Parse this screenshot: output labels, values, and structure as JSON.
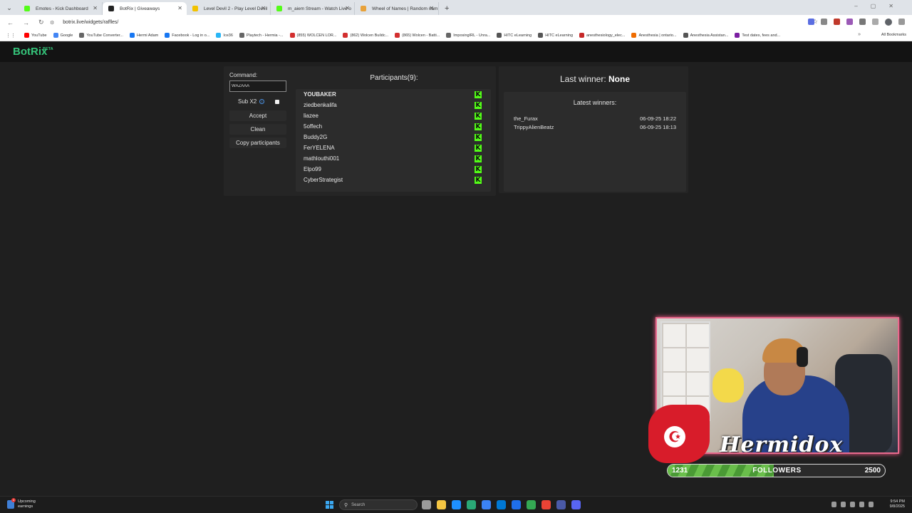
{
  "browser": {
    "tabs": [
      {
        "label": "Emotes - Kick Dashboard",
        "active": false,
        "color": "#53fc18"
      },
      {
        "label": "BotRix | Giveaways",
        "active": true,
        "color": "#222222"
      },
      {
        "label": "Level Devil 2 - Play Level Devil",
        "active": false,
        "color": "#f2c200"
      },
      {
        "label": "m_aiem Stream - Watch Live o",
        "active": false,
        "color": "#53fc18"
      },
      {
        "label": "Wheel of Names | Random nam",
        "active": false,
        "color": "#e8a23a"
      }
    ],
    "url": "botrix.live/widgets/raffles/",
    "bookmarks": [
      {
        "label": "YouTube",
        "color": "#ff0000"
      },
      {
        "label": "Google",
        "color": "#4285f4"
      },
      {
        "label": "YouTube Converter...",
        "color": "#666666"
      },
      {
        "label": "Hermi Adam",
        "color": "#1877f2"
      },
      {
        "label": "Facebook - Log in o...",
        "color": "#1877f2"
      },
      {
        "label": "Ice36",
        "color": "#29b6f6"
      },
      {
        "label": "Playtech - Hermia -...",
        "color": "#666666"
      },
      {
        "label": "(855) WOLCEN LOR...",
        "color": "#d32f2f"
      },
      {
        "label": "(862) Wolcen Buildc...",
        "color": "#d32f2f"
      },
      {
        "label": "(865) Wolcen - Batti...",
        "color": "#d32f2f"
      },
      {
        "label": "ImposingIRL - Unra...",
        "color": "#666666"
      },
      {
        "label": "HITC eLearning",
        "color": "#555555"
      },
      {
        "label": "HITC eLearning",
        "color": "#555555"
      },
      {
        "label": "anesthesiology_elec...",
        "color": "#c62828"
      },
      {
        "label": "Anesthesia | ontario...",
        "color": "#ef6c00"
      },
      {
        "label": "Anesthesia Assistan...",
        "color": "#555555"
      },
      {
        "label": "Test dates, fees and...",
        "color": "#7b1fa2"
      }
    ],
    "all_bookmarks_label": "All Bookmarks"
  },
  "app": {
    "logo": "BotRix",
    "logo_badge": "BETA",
    "command_label": "Command:",
    "command_value": "WAZAAA",
    "sub_label": "Sub X2",
    "accept_label": "Accept",
    "clean_label": "Clean",
    "copy_label": "Copy participants",
    "participants_title": "Participants(9):",
    "participants": [
      {
        "name": "YOUBAKER",
        "bold": true
      },
      {
        "name": "ziedbenkalifa",
        "bold": false
      },
      {
        "name": "liazee",
        "bold": false
      },
      {
        "name": "5offech",
        "bold": false
      },
      {
        "name": "Buddy2G",
        "bold": false
      },
      {
        "name": "FerYELENA",
        "bold": false
      },
      {
        "name": "mathlouthi001",
        "bold": false
      },
      {
        "name": "Elpo99",
        "bold": false
      },
      {
        "name": "CyberStrategist",
        "bold": false
      }
    ],
    "platform_glyph": "K",
    "last_winner_label": "Last winner:",
    "last_winner_value": "None",
    "latest_winners_title": "Latest winners:",
    "latest_winners": [
      {
        "name": "the_Furax",
        "date": "06-09-25 18:22"
      },
      {
        "name": "TrippyAlienBeatz",
        "date": "06-09-25 18:13"
      }
    ]
  },
  "overlay": {
    "streamer_name": "Hermidox",
    "followers_current": "1231",
    "followers_label": "FOLLOWERS",
    "followers_goal": "2500",
    "followers_fraction": 0.49
  },
  "taskbar": {
    "weather_line1": "Upcoming",
    "weather_line2": "earnings",
    "search_placeholder": "Search",
    "time": "9:54 PM",
    "date": "9/8/2025",
    "apps": [
      "#9a9a9a",
      "#f4c542",
      "#1e90ff",
      "#2aa876",
      "#3b82f6",
      "#0078d4",
      "#1f6feb",
      "#34a853",
      "#ea4335",
      "#4a5aa8",
      "#5865f2"
    ]
  }
}
